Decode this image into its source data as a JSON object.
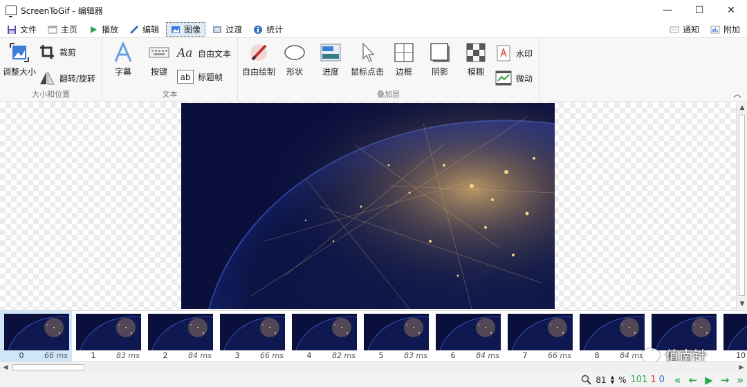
{
  "window": {
    "title": "ScreenToGif - 编辑器",
    "minimize": "—",
    "maximize": "☐",
    "close": "✕"
  },
  "tabs": [
    {
      "label": "文件"
    },
    {
      "label": "主页"
    },
    {
      "label": "播放"
    },
    {
      "label": "编辑"
    },
    {
      "label": "图像"
    },
    {
      "label": "过渡"
    },
    {
      "label": "统计"
    }
  ],
  "tabs_right": [
    {
      "label": "通知"
    },
    {
      "label": "附加"
    }
  ],
  "ribbon": {
    "size_group": {
      "label": "大小和位置",
      "resize": "调整大小",
      "crop": "裁剪",
      "flip_rotate": "翻转/旋转"
    },
    "text_group": {
      "label": "文本",
      "caption": "字幕",
      "keystrokes": "按键",
      "free_text": "自由文本",
      "title_frame": "标题帧"
    },
    "overlay_group": {
      "label": "叠加层",
      "free_drawing": "自由绘制",
      "shapes": "形状",
      "progress": "进度",
      "mouse_clicks": "鼠标点击",
      "border": "边框",
      "shadow": "阴影",
      "obfuscate": "模糊",
      "watermark": "水印",
      "cinemagraph": "微动"
    }
  },
  "frames": [
    {
      "num": "0",
      "delay": "66 ms"
    },
    {
      "num": "1",
      "delay": "83 ms"
    },
    {
      "num": "2",
      "delay": "84 ms"
    },
    {
      "num": "3",
      "delay": "66 ms"
    },
    {
      "num": "4",
      "delay": "82 ms"
    },
    {
      "num": "5",
      "delay": "83 ms"
    },
    {
      "num": "6",
      "delay": "84 ms"
    },
    {
      "num": "7",
      "delay": "66 ms"
    },
    {
      "num": "8",
      "delay": "84 ms"
    },
    {
      "num": "9",
      "delay": ""
    },
    {
      "num": "10",
      "delay": ""
    }
  ],
  "status": {
    "zoom": "81",
    "zoom_unit": "%",
    "frame_count": "101",
    "selected_count": "1",
    "selected_index": "0"
  },
  "watermark_text": "值南针",
  "colors": {
    "accent": "#2b6fc9",
    "nav_green": "#2aa84a",
    "count_green": "#2aa84a",
    "count_red": "#d9302c",
    "count_blue": "#2b6fc9"
  }
}
